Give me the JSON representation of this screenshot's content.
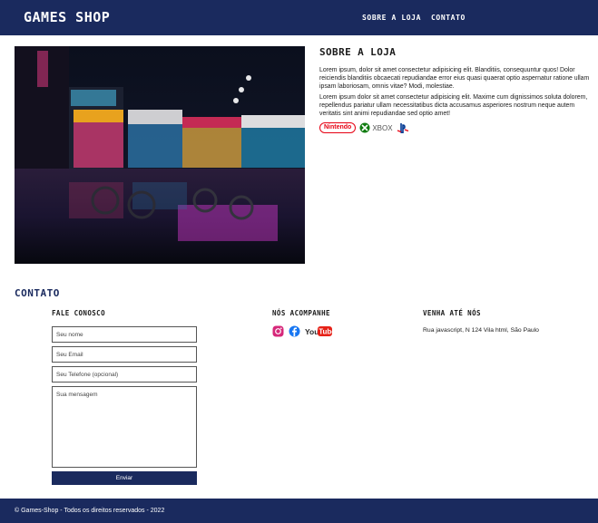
{
  "header": {
    "brand": "GAMES SHOP",
    "nav": [
      {
        "label": "SOBRE A LOJA"
      },
      {
        "label": "CONTATO"
      }
    ]
  },
  "about": {
    "title": "SOBRE A LOJA",
    "paragraphs": [
      "Lorem ipsum, dolor sit amet consectetur adipisicing elit. Blanditiis, consequuntur quos! Dolor reiciendis blanditiis obcaecati repudiandae error eius quasi quaerat optio aspernatur ratione ullam ipsam laboriosam, omnis vitae? Modi, molestiae.",
      "Lorem ipsum dolor sit amet consectetur adipisicing elit. Maxime cum dignissimos soluta dolorem, repellendus pariatur ullam necessitatibus dicta accusamus asperiores nostrum neque autem veritatis sint animi repudiandae sed optio amet!"
    ],
    "brands": {
      "nintendo": "Nintendo",
      "xbox": "XBOX"
    },
    "colors": {
      "nintendo": "#e60012",
      "xbox": "#107c10",
      "playstation": "#003791"
    }
  },
  "contact": {
    "title": "CONTATO",
    "form_title": "FALE CONOSCO",
    "social_title": "NÓS ACOMPANHE",
    "visit_title": "VENHA ATÉ NÓS",
    "fields": {
      "name": "Seu nome",
      "email": "Seu Email",
      "phone": "Seu Telefone (opcional)",
      "message": "Sua mensagem"
    },
    "send_label": "Enviar",
    "social": {
      "youtube_label": "YouTube"
    },
    "address": "Rua javascript, N 124 Vila html, São Paulo"
  },
  "footer": {
    "text": "© Games-Shop - Todos os direitos reservados - 2022"
  },
  "theme": {
    "primary": "#1a2a5e",
    "background": "#ffffff"
  },
  "icons": [
    "instagram-icon",
    "facebook-icon",
    "youtube-icon",
    "xbox-icon",
    "playstation-icon"
  ]
}
